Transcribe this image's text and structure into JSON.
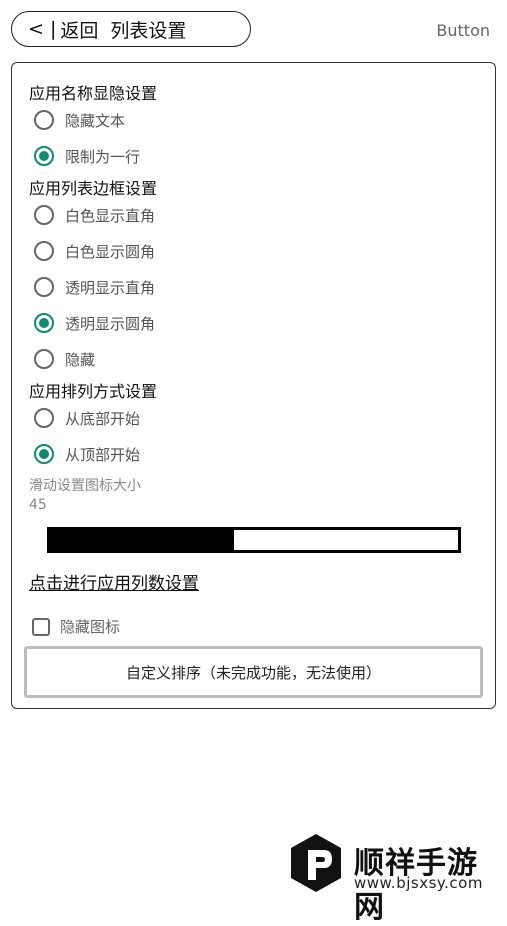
{
  "header": {
    "back_symbol": "< |",
    "back_label": "返回",
    "title": "列表设置",
    "right_button": "Button"
  },
  "name_section": {
    "title": "应用名称显隐设置",
    "options": [
      {
        "label": "隐藏文本",
        "selected": false
      },
      {
        "label": "限制为一行",
        "selected": true
      }
    ]
  },
  "border_section": {
    "title": "应用列表边框设置",
    "options": [
      {
        "label": "白色显示直角",
        "selected": false
      },
      {
        "label": "白色显示圆角",
        "selected": false
      },
      {
        "label": "透明显示直角",
        "selected": false
      },
      {
        "label": "透明显示圆角",
        "selected": true
      },
      {
        "label": "隐藏",
        "selected": false
      }
    ]
  },
  "order_section": {
    "title": "应用排列方式设置",
    "options": [
      {
        "label": "从底部开始",
        "selected": false
      },
      {
        "label": "从顶部开始",
        "selected": true
      }
    ]
  },
  "icon_size": {
    "label": "滑动设置图标大小",
    "value": "45",
    "fill_fraction": 0.45
  },
  "columns_link": "点击进行应用列数设置",
  "hide_icons": {
    "label": "隐藏图标",
    "checked": false
  },
  "custom_sort_button": "自定义排序（未完成功能，无法使用）",
  "watermark": {
    "name": "顺祥手游网",
    "url": "www.bjsxsy.com"
  },
  "colors": {
    "accent": "#0f8a73",
    "border": "#333333",
    "muted_text": "#888888"
  }
}
